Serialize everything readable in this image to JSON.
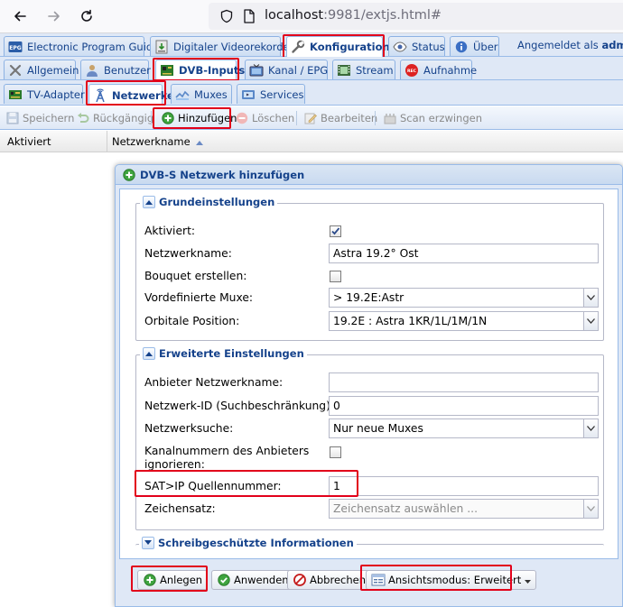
{
  "browser": {
    "url_host": "localhost",
    "url_rest": ":9981/extjs.html#"
  },
  "main_tabs": [
    {
      "label": "Electronic Program Guide",
      "icon": "epg-icon"
    },
    {
      "label": "Digitaler Videorekorder",
      "icon": "dvr-icon"
    },
    {
      "label": "Konfiguration",
      "icon": "wrench-icon",
      "active": true
    },
    {
      "label": "Status",
      "icon": "eye-icon"
    },
    {
      "label": "Über",
      "icon": "info-icon"
    }
  ],
  "login_text": "Angemeldet als ",
  "login_user": "admin",
  "sub_tabs": [
    {
      "label": "Allgemein",
      "icon": "tools-icon"
    },
    {
      "label": "Benutzer",
      "icon": "user-icon"
    },
    {
      "label": "DVB-Inputs",
      "icon": "dvb-card-icon",
      "active": true
    },
    {
      "label": "Kanal / EPG",
      "icon": "tv-icon"
    },
    {
      "label": "Stream",
      "icon": "film-icon"
    },
    {
      "label": "Aufnahme",
      "icon": "rec-icon"
    }
  ],
  "dvb_tabs": [
    {
      "label": "TV-Adapter",
      "icon": "adapter-icon"
    },
    {
      "label": "Netzwerke",
      "icon": "antenna-icon",
      "active": true
    },
    {
      "label": "Muxes",
      "icon": "muxes-icon"
    },
    {
      "label": "Services",
      "icon": "services-icon"
    }
  ],
  "toolbar": {
    "save": "Speichern",
    "undo": "Rückgängig",
    "add": "Hinzufügen",
    "delete": "Löschen",
    "edit": "Bearbeiten",
    "force_scan": "Scan erzwingen"
  },
  "grid": {
    "columns": [
      "Aktiviert",
      "Netzwerkname"
    ]
  },
  "dialog": {
    "title": "DVB-S Netzwerk hinzufügen",
    "basic_settings": {
      "legend": "Grundeinstellungen",
      "enabled_label": "Aktiviert:",
      "enabled_checked": true,
      "network_name_label": "Netzwerkname:",
      "network_name_value": "Astra 19.2° Ost",
      "bouquet_label": "Bouquet erstellen:",
      "bouquet_checked": false,
      "predefined_muxes_label": "Vordefinierte Muxe:",
      "predefined_muxes_value": "> 19.2E:Astr",
      "orbital_label": "Orbitale Position:",
      "orbital_value": "19.2E : Astra 1KR/1L/1M/1N"
    },
    "advanced_settings": {
      "legend": "Erweiterte Einstellungen",
      "provider_name_label": "Anbieter Netzwerkname:",
      "provider_name_value": "",
      "network_id_label": "Netzwerk-ID (Suchbeschränkung):",
      "network_id_value": "0",
      "network_discovery_label": "Netzwerksuche:",
      "network_discovery_value": "Nur neue Muxes",
      "provider_channel_numbers_label_1": "Kanalnummern des Anbieters",
      "provider_channel_numbers_label_2": "ignorieren:",
      "provider_channel_numbers_checked": false,
      "satip_source_label": "SAT>IP Quellennummer:",
      "satip_source_value": "1",
      "charset_label": "Zeichensatz:",
      "charset_placeholder": "Zeichensatz auswählen ..."
    },
    "readonly_info": {
      "legend": "Schreibgeschützte Informationen"
    },
    "buttons": {
      "create": "Anlegen",
      "apply": "Anwenden",
      "cancel": "Abbrechen",
      "view_mode": "Ansichtsmodus: Erweitert"
    }
  },
  "colors": {
    "highlight": "#e2001a",
    "tab_text": "#15428b",
    "panel_bg": "#dfe8f6"
  }
}
